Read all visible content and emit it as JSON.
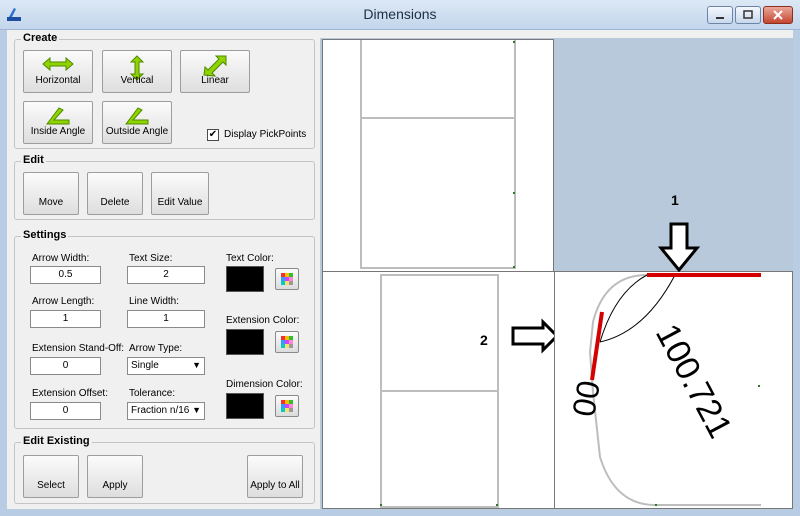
{
  "window": {
    "title": "Dimensions"
  },
  "create": {
    "title": "Create",
    "horizontal_label": "Horizontal",
    "vertical_label": "Vertical",
    "linear_label": "Linear",
    "inside_angle_label": "Inside Angle",
    "outside_angle_label": "Outside Angle",
    "display_pickpoints_label": "Display PickPoints",
    "display_pickpoints_checked": "✔"
  },
  "edit": {
    "title": "Edit",
    "move_label": "Move",
    "delete_label": "Delete",
    "edit_value_label": "Edit Value"
  },
  "settings": {
    "title": "Settings",
    "arrow_width_label": "Arrow Width:",
    "arrow_width_value": "0.5",
    "text_size_label": "Text Size:",
    "text_size_value": "2",
    "text_color_label": "Text Color:",
    "arrow_length_label": "Arrow Length:",
    "arrow_length_value": "1",
    "line_width_label": "Line Width:",
    "line_width_value": "1",
    "extension_color_label": "Extension Color:",
    "extension_standoff_label": "Extension Stand-Off:",
    "extension_standoff_value": "0",
    "arrow_type_label": "Arrow Type:",
    "arrow_type_value": "Single",
    "dimension_color_label": "Dimension Color:",
    "extension_offset_label": "Extension Offset:",
    "extension_offset_value": "0",
    "tolerance_label": "Tolerance:",
    "tolerance_value": "Fraction n/16",
    "text_color": "#000000",
    "extension_color": "#000000",
    "dimension_color": "#000000"
  },
  "edit_existing": {
    "title": "Edit Existing",
    "select_label": "Select",
    "apply_label": "Apply",
    "apply_all_label": "Apply to All"
  },
  "viewport": {
    "callout_1": "1",
    "callout_2": "2",
    "dimension_text": "100.721",
    "partial_text": "00",
    "highlight_color": "#d40000"
  }
}
